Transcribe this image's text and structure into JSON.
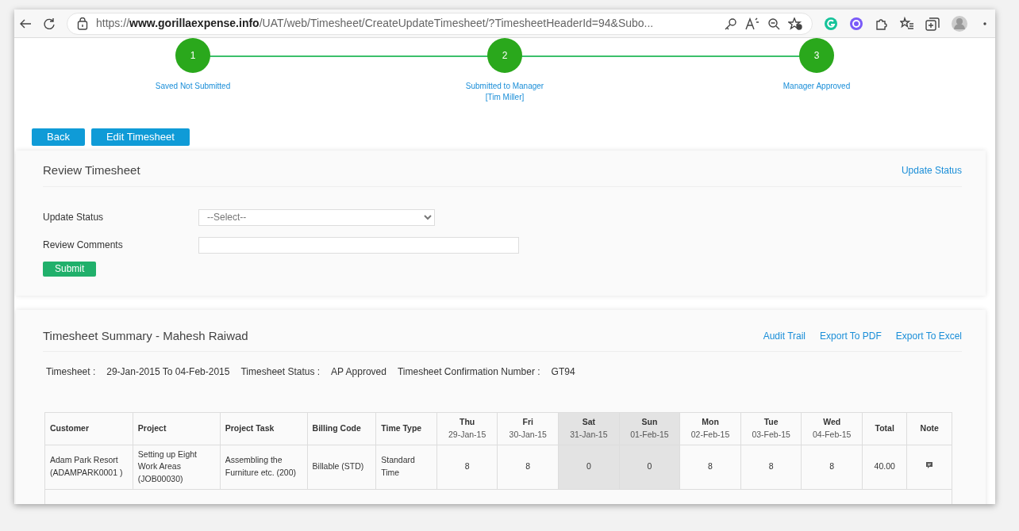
{
  "browser": {
    "url": "https://**www.gorillaexpense.info**/UAT/web/Timesheet/CreateUpdateTimesheet/?TimesheetHeaderId=94&Subo..."
  },
  "steps": [
    {
      "number": "1",
      "lines": [
        "Saved Not Submitted"
      ],
      "completed": true
    },
    {
      "number": "2",
      "lines": [
        "Submitted to Manager",
        "[Tim Miller]"
      ],
      "completed": true
    },
    {
      "number": "3",
      "lines": [
        "Manager Approved"
      ],
      "completed": true
    }
  ],
  "buttons": [
    "Back",
    "Edit Timesheet"
  ],
  "review": {
    "title": "Review Timesheet",
    "link": "Update Status",
    "fields": [
      {
        "label": "Update Status",
        "kind": "select",
        "value": "--Select--"
      },
      {
        "label": "Review Comments",
        "kind": "text"
      }
    ],
    "submit": "Submit"
  },
  "summary": {
    "title": "Timesheet Summary - Mahesh Raiwad",
    "links": [
      "Audit Trail",
      "Export To PDF",
      "Export To Excel"
    ],
    "info": [
      {
        "label": "Timesheet :",
        "value": "29-Jan-2015 To 04-Feb-2015"
      },
      {
        "label": "Timesheet Status :",
        "value": "AP Approved"
      },
      {
        "label": "Timesheet Confirmation Number :",
        "value": "GT94"
      }
    ]
  },
  "table": {
    "columns": [
      {
        "kind": "text",
        "name": "Customer"
      },
      {
        "kind": "text",
        "name": "Project"
      },
      {
        "kind": "text",
        "name": "Project Task"
      },
      {
        "kind": "text",
        "name": "Billing Code"
      },
      {
        "kind": "text",
        "name": "Time Type"
      },
      {
        "kind": "day",
        "name": "Thu",
        "date": "29-Jan-15",
        "weekend": false
      },
      {
        "kind": "day",
        "name": "Fri",
        "date": "30-Jan-15",
        "weekend": false
      },
      {
        "kind": "day",
        "name": "Sat",
        "date": "31-Jan-15",
        "weekend": true
      },
      {
        "kind": "day",
        "name": "Sun",
        "date": "01-Feb-15",
        "weekend": true
      },
      {
        "kind": "day",
        "name": "Mon",
        "date": "02-Feb-15",
        "weekend": false
      },
      {
        "kind": "day",
        "name": "Tue",
        "date": "03-Feb-15",
        "weekend": false
      },
      {
        "kind": "day",
        "name": "Wed",
        "date": "04-Feb-15",
        "weekend": false
      },
      {
        "kind": "text",
        "name": "Total"
      },
      {
        "kind": "note",
        "name": "Note"
      }
    ],
    "rows": [
      {
        "cells": [
          "Adam Park Resort (ADAMPARK0001 )",
          "Setting up Eight Work Areas (JOB00030)",
          "Assembling the Furniture etc. (200)",
          "Billable (STD)",
          "Standard Time",
          "8",
          "8",
          "0",
          "0",
          "8",
          "8",
          "8",
          "40.00"
        ],
        "has_note": true
      }
    ]
  }
}
